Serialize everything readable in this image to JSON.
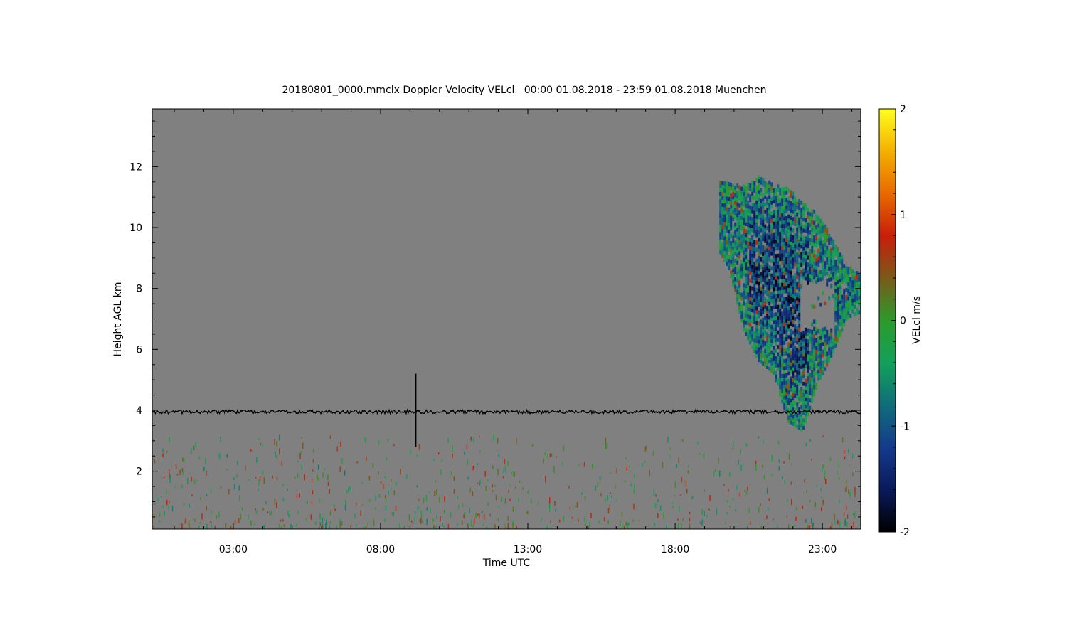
{
  "chart_data": {
    "type": "heatmap",
    "title": "20180801_0000.mmclx Doppler Velocity VELcl   00:00 01.08.2018 - 23:59 01.08.2018 Muenchen",
    "xlabel": "Time UTC",
    "ylabel": "Height AGL km",
    "x_unit": "hours UTC",
    "xlim": [
      0.25,
      24.3
    ],
    "ylim": [
      0.1,
      13.9
    ],
    "x_ticks": [
      {
        "value": 3,
        "label": "03:00"
      },
      {
        "value": 8,
        "label": "08:00"
      },
      {
        "value": 13,
        "label": "13:00"
      },
      {
        "value": 18,
        "label": "18:00"
      },
      {
        "value": 23,
        "label": "23:00"
      }
    ],
    "y_ticks": [
      {
        "value": 2,
        "label": "2"
      },
      {
        "value": 4,
        "label": "4"
      },
      {
        "value": 6,
        "label": "6"
      },
      {
        "value": 8,
        "label": "8"
      },
      {
        "value": 10,
        "label": "10"
      },
      {
        "value": 12,
        "label": "12"
      }
    ],
    "colorbar": {
      "label": "VELcl m/s",
      "range": [
        -2,
        2
      ],
      "ticks": [
        {
          "value": 2,
          "label": "2"
        },
        {
          "value": 1,
          "label": "1"
        },
        {
          "value": 0,
          "label": "0"
        },
        {
          "value": -1,
          "label": "-1"
        },
        {
          "value": -2,
          "label": "-2"
        }
      ],
      "colors": [
        "#000000",
        "#0a1a5a",
        "#153a8c",
        "#0f6e7a",
        "#13a05a",
        "#2c9a2a",
        "#7a5a1a",
        "#c81e0a",
        "#e86a00",
        "#f4b000",
        "#ffff20"
      ]
    },
    "background_color": "#808080",
    "features": [
      {
        "name": "line at 4 km",
        "height_km": 3.95,
        "x_range": [
          0.25,
          24.3
        ],
        "color": "#000000"
      },
      {
        "name": "vertical spike",
        "x": 9.2,
        "y_range": [
          2.8,
          5.2
        ],
        "color": "#000000"
      },
      {
        "name": "upper cloud",
        "x_range": [
          19.5,
          24.3
        ],
        "y_range": [
          3.2,
          11.8
        ],
        "mean_velocity": -0.5
      },
      {
        "name": "low clutter",
        "x_range": [
          0.25,
          24.3
        ],
        "y_range": [
          0.2,
          3.2
        ],
        "mean_velocity": 0.0
      }
    ]
  }
}
